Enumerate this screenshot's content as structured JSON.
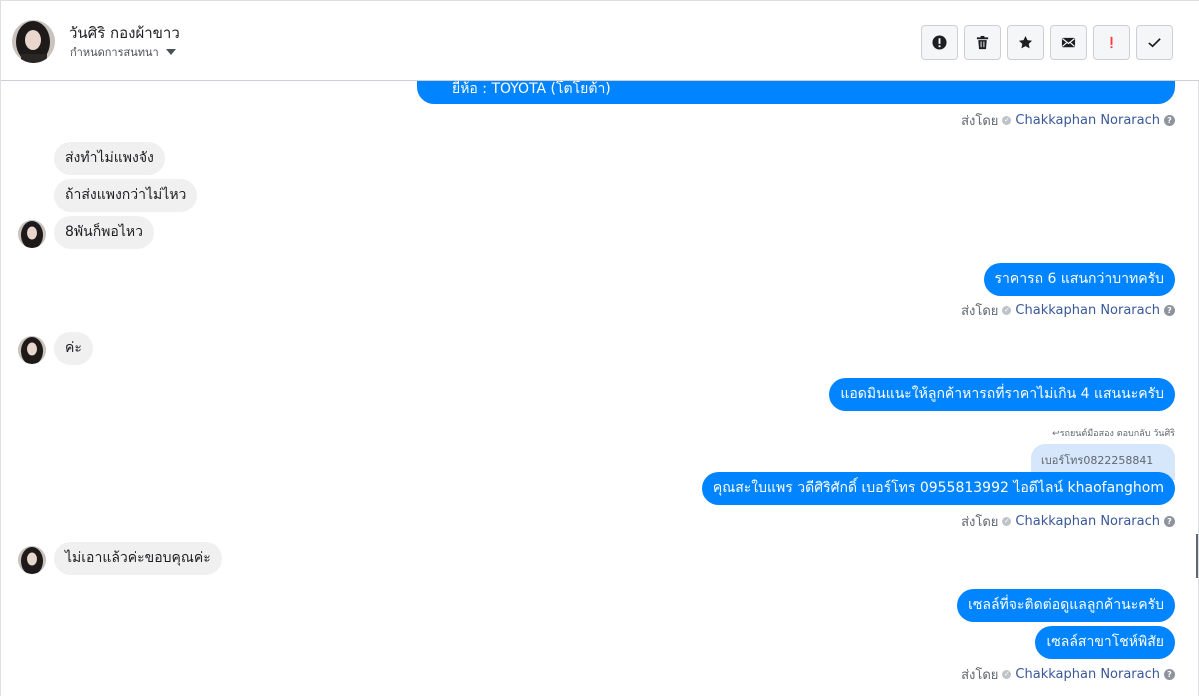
{
  "header": {
    "contact_name": "วันศิริ กองผ้าขาว",
    "subtitle": "กำหนดการสนทนา",
    "toolbar": [
      {
        "name": "spam-button",
        "icon": "exclamation-circle-icon"
      },
      {
        "name": "delete-button",
        "icon": "trash-icon"
      },
      {
        "name": "star-button",
        "icon": "star-icon"
      },
      {
        "name": "mark-unread-button",
        "icon": "envelope-icon"
      },
      {
        "name": "priority-button",
        "icon": "exclamation-red-icon"
      },
      {
        "name": "done-button",
        "icon": "checkmark-icon"
      }
    ]
  },
  "messages": {
    "m1": "ยี่ห้อ : TOYOTA (โตโยต้า)",
    "m2": "ส่งทำไม่แพงจัง",
    "m3": "ถ้าส่งแพงกว่าไม่ไหว",
    "m4": "8พันก็พอไหว",
    "m5": "ราคารถ 6 แสนกว่าบาทครับ",
    "m6": "ค่ะ",
    "m7": "แอดมินแนะให้ลูกค้าหารถที่ราคาไม่เกิน 4 แสนนะครับ",
    "reply_label": "↩รถยนต์มือสอง ตอบกลับ วันศิริ",
    "quoted": "เบอร์โทร0822258841",
    "m8": "คุณสะใบแพร วดีศิริศักดิ์ เบอร์โทร 0955813992  ไอดีไลน์  khaofanghom",
    "m9": "ไม่เอาแล้วค่ะขอบคุณค่ะ",
    "m10": "เซลล์ที่จะติดต่อดูแลลูกค้านะครับ",
    "m11": "เซลล์สาขาโชห์พิสัย"
  },
  "sent_by": {
    "prefix": "ส่งโดย",
    "agent": "Chakkaphan Norarach"
  },
  "colors": {
    "outgoing": "#0084ff",
    "incoming": "#f1f0f0",
    "agent_link": "#385898"
  }
}
